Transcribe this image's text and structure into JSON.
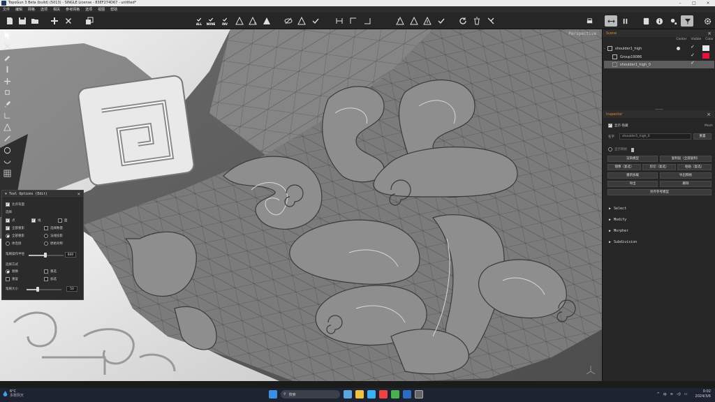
{
  "window": {
    "title": "TopoGun 3 Beta (build) (5013) - SINGLE License - 83EF274D67 - untitled*"
  },
  "menubar": [
    "文件",
    "编辑",
    "网格",
    "选项",
    "相关",
    "参考网格",
    "选项",
    "视图",
    "帮助"
  ],
  "toolbar": {
    "select_all": "ALL",
    "select_none": "NONE",
    "select_inv": "INV"
  },
  "viewport": {
    "camera_label": "Perspective"
  },
  "tool_options": {
    "title": "Tool Options (Edit)",
    "show_backface": "允许背面",
    "section_select": "选择",
    "opt_point": "点",
    "opt_edge": "线",
    "opt_face": "面",
    "opt_soft_select": "全部重影",
    "opt_soft_alt": "选择数量",
    "opt_radio_a": "全部重影",
    "opt_radio_b": "法线投影",
    "opt_radio_c": "体连接",
    "opt_radio_d": "原始对称",
    "brush_radius_label": "笔刷操作半径",
    "brush_radius_value": "800",
    "section_mode": "选择方式",
    "mode_a": "替换",
    "mode_b": "重选",
    "mode_c": "重复",
    "mode_d": "加选",
    "brush_size_label": "笔刷大小",
    "brush_size_value": "50"
  },
  "scene": {
    "title": "Scene",
    "col_center": "Center",
    "col_visible": "Visible",
    "col_color": "Color",
    "rows": [
      {
        "name": "shoulder1_high",
        "color": "#e8e8e8"
      },
      {
        "name": "Group19086",
        "color": "#e8123a"
      },
      {
        "name": "shoulder1_high_0",
        "color": ""
      }
    ]
  },
  "inspector": {
    "title": "Inspector",
    "show_label": "显示-隐藏",
    "mesh_label": "Mesh",
    "name_label": "名字",
    "name_value": "shoulder1_high_0",
    "rename_btn": "重置",
    "display_label": "显示网格",
    "buttons": [
      "渲染模型",
      "复制层（全部复制）",
      "镜像（复选）",
      "剪切（复选）",
      "粘贴（复选）",
      "重新加载",
      "导出网格",
      "导出",
      "删除",
      "另存参考模型"
    ],
    "sections": [
      "Select",
      "Modify",
      "Morpher",
      "Subdivision"
    ]
  },
  "taskbar": {
    "temp": "6°C",
    "weather": "多数阴天",
    "search_placeholder": "搜索",
    "time": "0:02",
    "date": "2024/3/6"
  },
  "colors": {
    "accent_orange": "#e08a2c",
    "color_swatch_red": "#e8123a"
  }
}
